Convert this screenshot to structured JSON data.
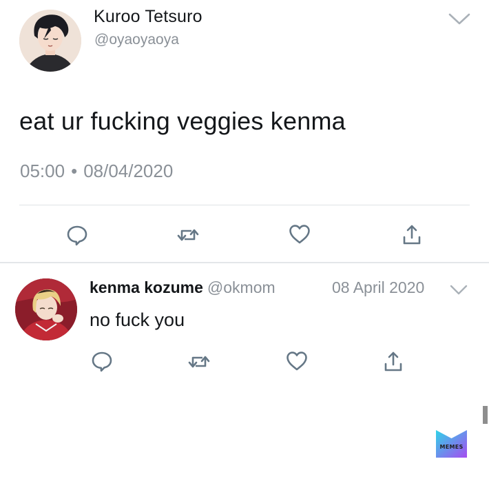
{
  "tweet": {
    "author_name": "Kuroo Tetsuro",
    "author_handle": "@oyaoyaoya",
    "text": "eat ur fucking veggies kenma",
    "time": "05:00",
    "separator": "•",
    "date": "08/04/2020",
    "actions": [
      "reply-icon",
      "retweet-icon",
      "like-icon",
      "share-icon"
    ]
  },
  "reply": {
    "author_name": "kenma kozume",
    "author_handle": "@okmom",
    "date": "08 April 2020",
    "text": "no fuck you",
    "actions": [
      "reply-icon",
      "retweet-icon",
      "like-icon",
      "share-icon"
    ]
  },
  "watermark": {
    "label": "MEMES"
  },
  "colors": {
    "text_primary": "#14171a",
    "text_secondary": "#8a9097",
    "icon": "#657786",
    "divider": "#dfe3e6",
    "watermark_gradient": [
      "#2fd4e8",
      "#a64cf0"
    ]
  }
}
